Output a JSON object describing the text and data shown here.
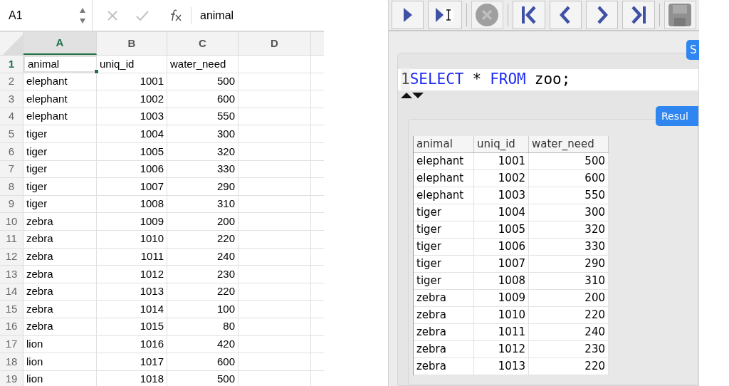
{
  "spreadsheet": {
    "name_box": "A1",
    "formula": "animal",
    "columns": [
      {
        "label": "A",
        "selected": true
      },
      {
        "label": "B",
        "selected": false
      },
      {
        "label": "C",
        "selected": false
      },
      {
        "label": "D",
        "selected": false
      }
    ],
    "rows": [
      {
        "number": "1",
        "selected": true,
        "cells": [
          "animal",
          "uniq_id",
          "water_need"
        ]
      },
      {
        "number": "2",
        "selected": false,
        "cells": [
          "elephant",
          "1001",
          "500"
        ]
      },
      {
        "number": "3",
        "selected": false,
        "cells": [
          "elephant",
          "1002",
          "600"
        ]
      },
      {
        "number": "4",
        "selected": false,
        "cells": [
          "elephant",
          "1003",
          "550"
        ]
      },
      {
        "number": "5",
        "selected": false,
        "cells": [
          "tiger",
          "1004",
          "300"
        ]
      },
      {
        "number": "6",
        "selected": false,
        "cells": [
          "tiger",
          "1005",
          "320"
        ]
      },
      {
        "number": "7",
        "selected": false,
        "cells": [
          "tiger",
          "1006",
          "330"
        ]
      },
      {
        "number": "8",
        "selected": false,
        "cells": [
          "tiger",
          "1007",
          "290"
        ]
      },
      {
        "number": "9",
        "selected": false,
        "cells": [
          "tiger",
          "1008",
          "310"
        ]
      },
      {
        "number": "10",
        "selected": false,
        "cells": [
          "zebra",
          "1009",
          "200"
        ]
      },
      {
        "number": "11",
        "selected": false,
        "cells": [
          "zebra",
          "1010",
          "220"
        ]
      },
      {
        "number": "12",
        "selected": false,
        "cells": [
          "zebra",
          "1011",
          "240"
        ]
      },
      {
        "number": "13",
        "selected": false,
        "cells": [
          "zebra",
          "1012",
          "230"
        ]
      },
      {
        "number": "14",
        "selected": false,
        "cells": [
          "zebra",
          "1013",
          "220"
        ]
      },
      {
        "number": "15",
        "selected": false,
        "cells": [
          "zebra",
          "1014",
          "100"
        ]
      },
      {
        "number": "16",
        "selected": false,
        "cells": [
          "zebra",
          "1015",
          "80"
        ]
      },
      {
        "number": "17",
        "selected": false,
        "cells": [
          "lion",
          "1016",
          "420"
        ]
      },
      {
        "number": "18",
        "selected": false,
        "cells": [
          "lion",
          "1017",
          "600"
        ]
      },
      {
        "number": "19",
        "selected": false,
        "cells": [
          "lion",
          "1018",
          "500"
        ]
      }
    ]
  },
  "sql_tool": {
    "toolbar": [
      {
        "kind": "run",
        "disabled": false
      },
      {
        "kind": "run-cursor",
        "disabled": false
      },
      {
        "kind": "stop",
        "disabled": true
      },
      {
        "kind": "first",
        "disabled": false
      },
      {
        "kind": "prev",
        "disabled": false
      },
      {
        "kind": "next",
        "disabled": false
      },
      {
        "kind": "last",
        "disabled": false
      },
      {
        "kind": "save",
        "disabled": true
      }
    ],
    "top_button": "S",
    "editor": {
      "line_number": "1",
      "tokens": [
        {
          "text": "SELECT",
          "kind": "keyword"
        },
        {
          "text": "*",
          "kind": "plain"
        },
        {
          "text": "FROM",
          "kind": "keyword"
        },
        {
          "text": "zoo;",
          "kind": "plain"
        }
      ]
    },
    "results_button": "Resul",
    "results": {
      "columns": [
        "animal",
        "uniq_id",
        "water_need"
      ],
      "rows": [
        [
          "elephant",
          "1001",
          "500"
        ],
        [
          "elephant",
          "1002",
          "600"
        ],
        [
          "elephant",
          "1003",
          "550"
        ],
        [
          "tiger",
          "1004",
          "300"
        ],
        [
          "tiger",
          "1005",
          "320"
        ],
        [
          "tiger",
          "1006",
          "330"
        ],
        [
          "tiger",
          "1007",
          "290"
        ],
        [
          "tiger",
          "1008",
          "310"
        ],
        [
          "zebra",
          "1009",
          "200"
        ],
        [
          "zebra",
          "1010",
          "220"
        ],
        [
          "zebra",
          "1011",
          "240"
        ],
        [
          "zebra",
          "1012",
          "230"
        ],
        [
          "zebra",
          "1013",
          "220"
        ]
      ]
    }
  }
}
